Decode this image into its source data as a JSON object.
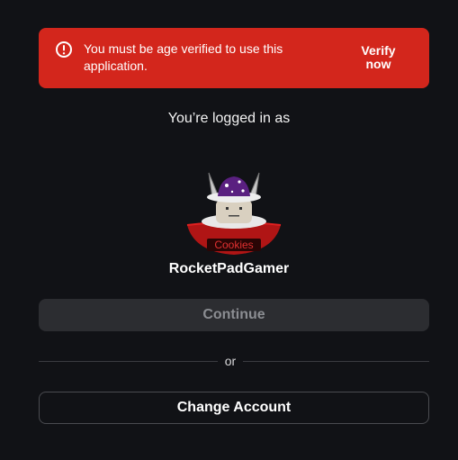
{
  "alert": {
    "icon": "alert-circle-icon",
    "message": "You must be age verified to use this application.",
    "action_label_line1": "Verify",
    "action_label_line2": "now",
    "color": "#d3261c"
  },
  "login": {
    "label": "You’re logged in as",
    "username": "RocketPadGamer",
    "avatar_badge_text": "Cookies"
  },
  "buttons": {
    "continue_label": "Continue",
    "or_label": "or",
    "change_account_label": "Change Account"
  }
}
